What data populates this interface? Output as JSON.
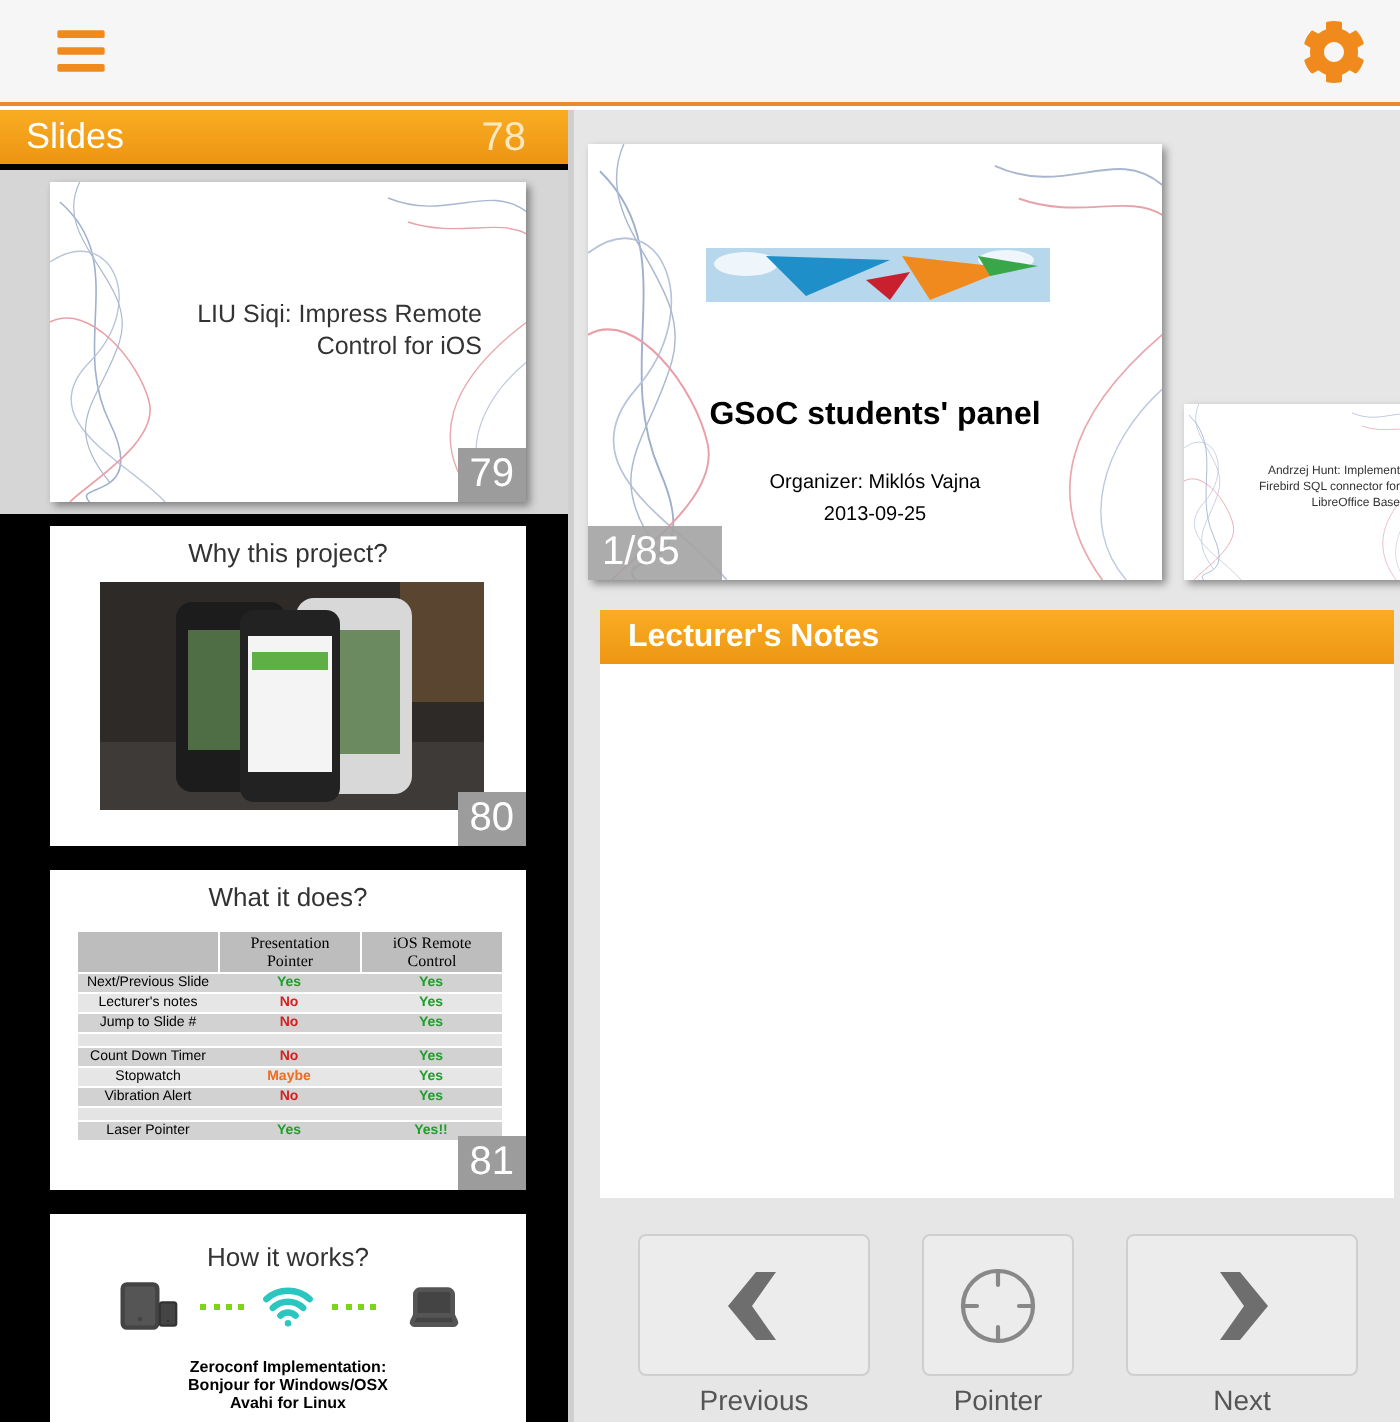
{
  "sidebar": {
    "title": "Slides",
    "partial_slide_number": "78",
    "slides": [
      {
        "kind": "title",
        "number": "79",
        "selected": true,
        "title": "LIU Siqi: Impress Remote Control for iOS"
      },
      {
        "number": "80",
        "selected": false,
        "title": "Why this project?"
      },
      {
        "kind": "table",
        "number": "81",
        "selected": false,
        "title": "What it does?",
        "columns": [
          "Presentation Pointer",
          "iOS Remote Control"
        ],
        "rows": [
          {
            "kind": "row",
            "label": "Next/Previous Slide",
            "cells": [
              {
                "text": "Yes",
                "color": "#1f9d2a"
              },
              {
                "text": "Yes",
                "color": "#1f9d2a"
              }
            ]
          },
          {
            "kind": "row",
            "label": "Lecturer's notes",
            "cells": [
              {
                "text": "No",
                "color": "#d42020"
              },
              {
                "text": "Yes",
                "color": "#1f9d2a"
              }
            ]
          },
          {
            "kind": "row",
            "label": "Jump to Slide #",
            "cells": [
              {
                "text": "No",
                "color": "#d42020"
              },
              {
                "text": "Yes",
                "color": "#1f9d2a"
              }
            ]
          },
          {
            "kind": "spacer"
          },
          {
            "kind": "row",
            "label": "Count Down Timer",
            "cells": [
              {
                "text": "No",
                "color": "#d42020"
              },
              {
                "text": "Yes",
                "color": "#1f9d2a"
              }
            ]
          },
          {
            "kind": "row",
            "label": "Stopwatch",
            "cells": [
              {
                "text": "Maybe",
                "color": "#f26a1b"
              },
              {
                "text": "Yes",
                "color": "#1f9d2a"
              }
            ]
          },
          {
            "kind": "row",
            "label": "Vibration Alert",
            "cells": [
              {
                "text": "No",
                "color": "#d42020"
              },
              {
                "text": "Yes",
                "color": "#1f9d2a"
              }
            ]
          },
          {
            "kind": "spacer"
          },
          {
            "kind": "row",
            "label": "Laser Pointer",
            "cells": [
              {
                "text": "Yes",
                "color": "#1f9d2a"
              },
              {
                "text": "Yes!!",
                "color": "#1f9d2a"
              }
            ]
          }
        ]
      },
      {
        "kind": "diagram",
        "selected": false,
        "title": "How it works?",
        "lines": [
          "Zeroconf Implementation:",
          "Bonjour for Windows/OSX",
          "Avahi for Linux"
        ]
      }
    ]
  },
  "current_slide": {
    "title": "GSoC students' panel",
    "organizer": "Organizer: Miklós Vajna",
    "date": "2013-09-25",
    "counter": "1/85"
  },
  "next_slide": {
    "title": "Andrzej Hunt: Implement Firebird SQL connector for LibreOffice Base"
  },
  "notes": {
    "title": "Lecturer's Notes"
  },
  "controls": [
    {
      "kind": "previous",
      "label": "Previous"
    },
    {
      "kind": "pointer",
      "label": "Pointer"
    },
    {
      "kind": "next",
      "label": "Next"
    }
  ]
}
